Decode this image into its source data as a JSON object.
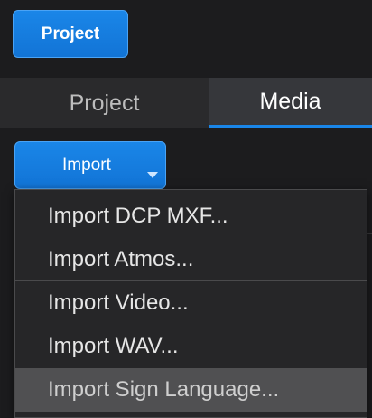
{
  "header": {
    "project_button_label": "Project"
  },
  "tabs": [
    {
      "label": "Project",
      "active": false
    },
    {
      "label": "Media",
      "active": true
    }
  ],
  "import": {
    "button_label": "Import"
  },
  "menu": {
    "items": [
      {
        "label": "Import DCP MXF..."
      },
      {
        "label": "Import Atmos..."
      },
      {
        "label": "Import Video..."
      },
      {
        "label": "Import WAV..."
      },
      {
        "label": "Import Sign Language...",
        "highlighted": true
      }
    ]
  },
  "colors": {
    "accent": "#1a86e8",
    "background": "#1c1c1e",
    "menu_background": "#262628",
    "highlight": "#505052"
  }
}
